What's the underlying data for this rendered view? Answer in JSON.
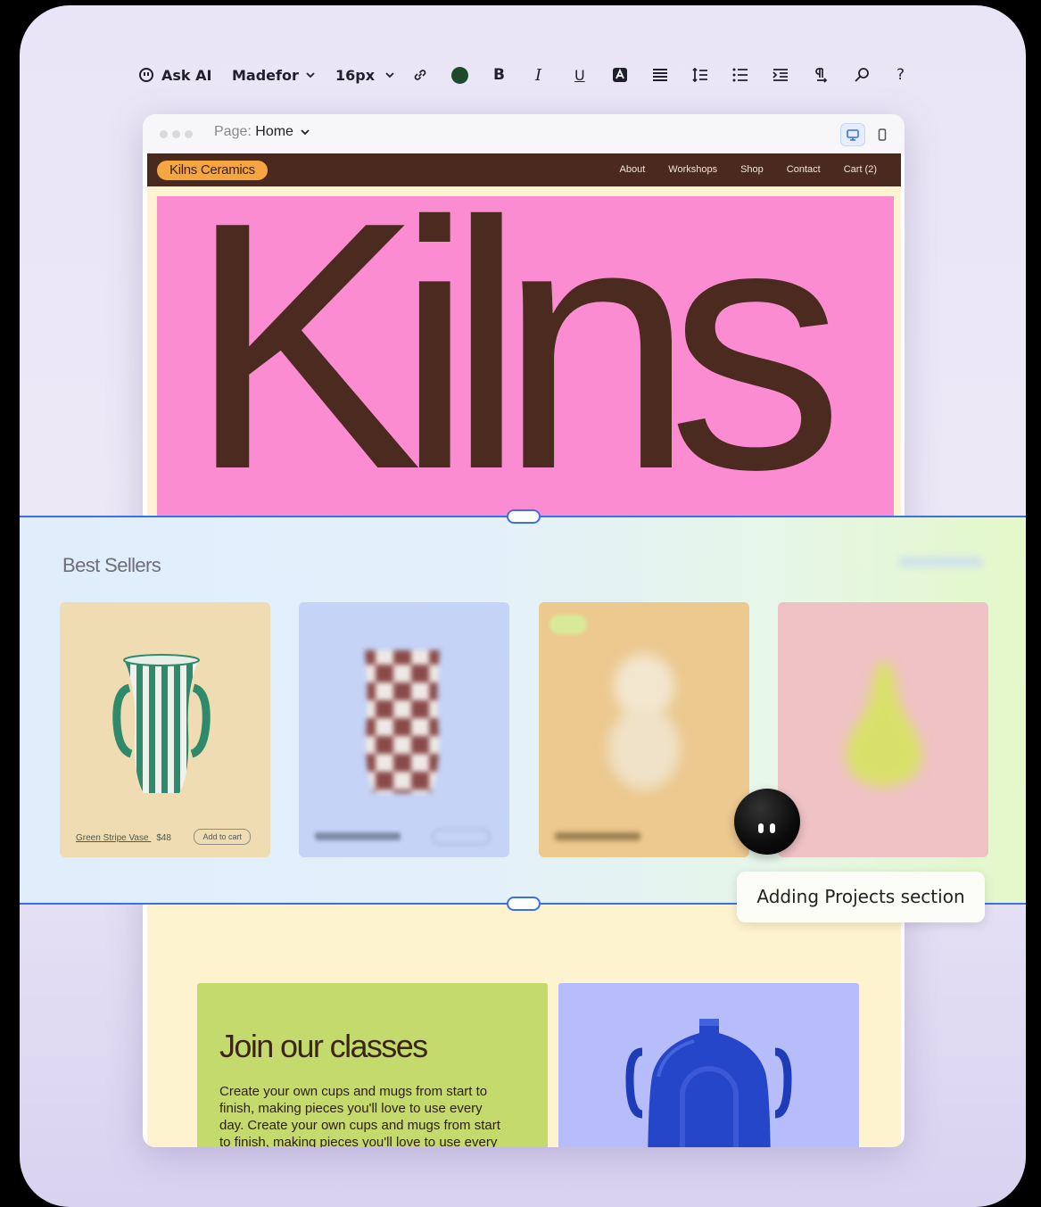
{
  "toolbar": {
    "ask_ai": "Ask AI",
    "font": "Madefor",
    "font_size": "16px",
    "text_color": "#1d4a2a",
    "bold": "B",
    "italic": "I",
    "underline": "U",
    "help": "?"
  },
  "editor": {
    "page_label": "Page:",
    "page_name": "Home"
  },
  "site": {
    "brand": "Kilns Ceramics",
    "nav": [
      "About",
      "Workshops",
      "Shop",
      "Contact",
      "Cart (2)"
    ],
    "hero_title": "Kilns",
    "colors": {
      "nav": "#4a2a1f",
      "hero": "#fc8cd1",
      "hero_text": "#4b2a20",
      "brand_pill": "#f5a640"
    }
  },
  "best_sellers": {
    "title": "Best Sellers",
    "products": [
      {
        "name": "Green Stripe Vase",
        "price": "$48",
        "cta": "Add to cart",
        "bg": "#f0dcb2"
      },
      {
        "name": "",
        "price": "",
        "cta": "",
        "bg": "#c5d3f6"
      },
      {
        "name": "",
        "price": "",
        "cta": "",
        "bg": "#ecc98f"
      },
      {
        "name": "",
        "price": "",
        "cta": "",
        "bg": "#efc2c5"
      }
    ]
  },
  "ai_status": "Adding Projects section",
  "classes": {
    "title": "Join our classes",
    "body": "Create your own cups and mugs from start to finish, making pieces you'll love to use every day. Create your own cups and mugs from start to finish, making pieces you'll love to use every day."
  }
}
